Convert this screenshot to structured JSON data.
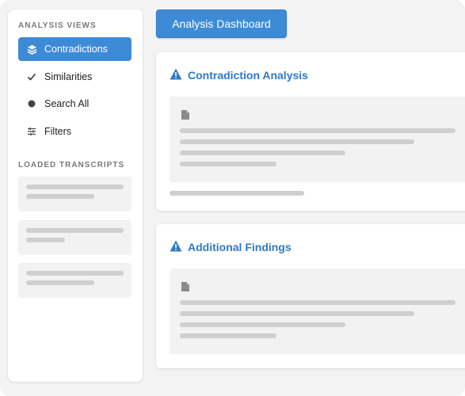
{
  "sidebar": {
    "analysis_views_label": "ANALYSIS VIEWS",
    "items": [
      {
        "label": "Contradictions",
        "icon": "layers-icon",
        "active": true
      },
      {
        "label": "Similarities",
        "icon": "check-icon",
        "active": false
      },
      {
        "label": "Search All",
        "icon": "dot-icon",
        "active": false
      },
      {
        "label": "Filters",
        "icon": "sliders-icon",
        "active": false
      }
    ],
    "loaded_transcripts_label": "LOADED TRANSCRIPTS"
  },
  "header": {
    "button_label": "Analysis Dashboard"
  },
  "panels": [
    {
      "title": "Contradiction Analysis",
      "icon": "warning-icon"
    },
    {
      "title": "Additional Findings",
      "icon": "warning-icon"
    }
  ],
  "colors": {
    "accent": "#3d8bd6",
    "title_blue": "#2f7ac4",
    "placeholder": "#cfcfcf",
    "background": "#f3f3f3"
  }
}
